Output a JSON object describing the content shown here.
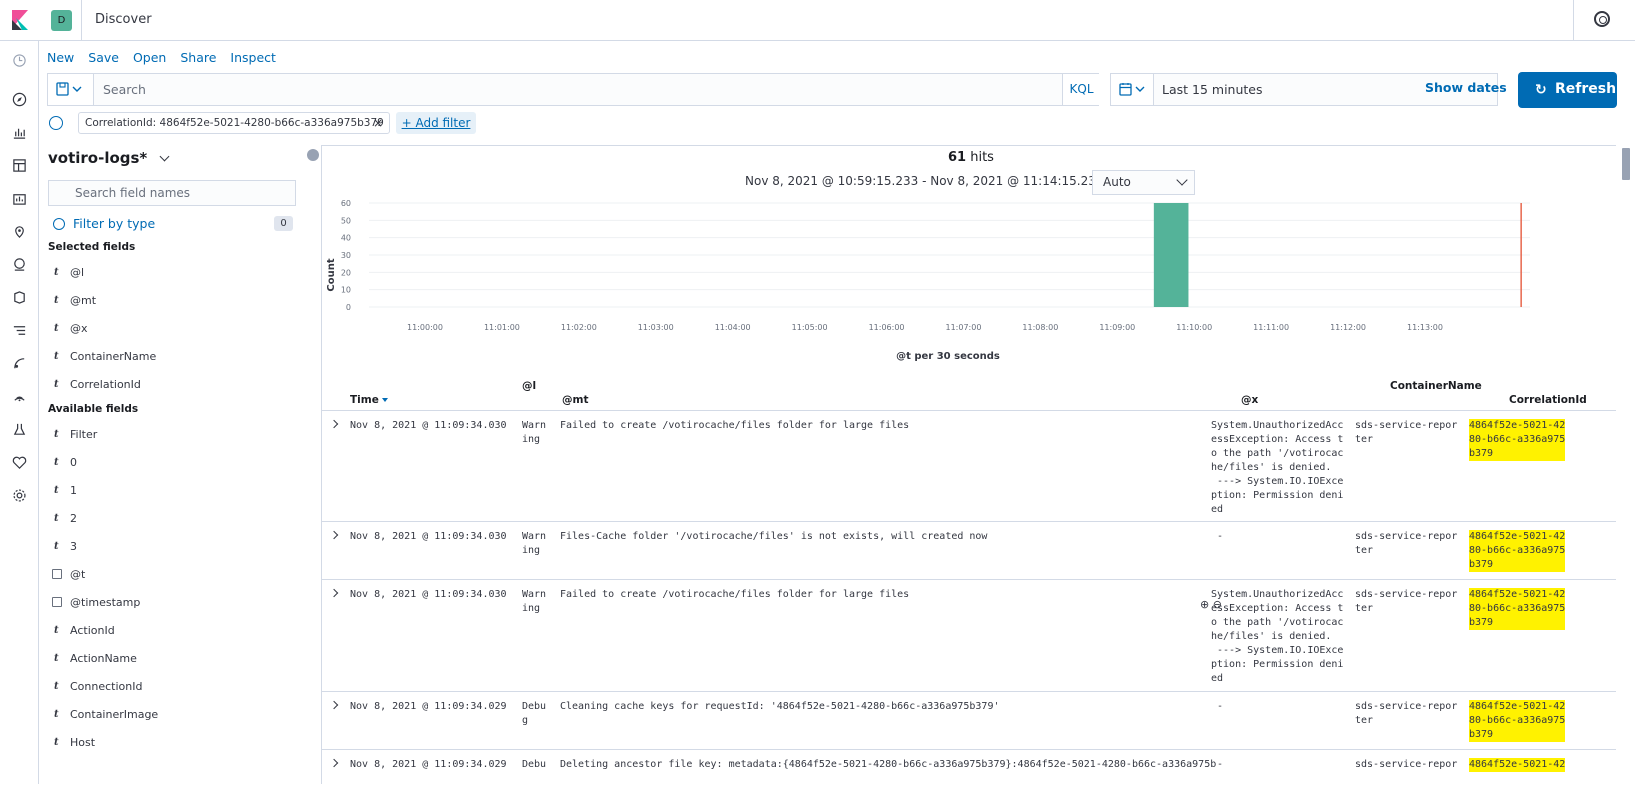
{
  "header": {
    "app_title": "Discover",
    "space_initial": "D"
  },
  "topnav": {
    "items": [
      "New",
      "Save",
      "Open",
      "Share",
      "Inspect"
    ]
  },
  "querybar": {
    "placeholder": "Search",
    "language": "KQL"
  },
  "datepicker": {
    "range": "Last 15 minutes",
    "show_dates": "Show dates",
    "refresh": "Refresh"
  },
  "filters": {
    "pills": [
      {
        "label": "CorrelationId: 4864f52e-5021-4280-b66c-a336a975b379"
      }
    ],
    "add_filter": "+ Add filter"
  },
  "sidebar": {
    "index_pattern": "votiro-logs*",
    "search_placeholder": "Search field names",
    "filter_by_type": "Filter by type",
    "filter_count": "0",
    "selected_title": "Selected fields",
    "selected_fields": [
      {
        "type": "t",
        "name": "@l"
      },
      {
        "type": "t",
        "name": "@mt"
      },
      {
        "type": "t",
        "name": "@x"
      },
      {
        "type": "t",
        "name": "ContainerName"
      },
      {
        "type": "t",
        "name": "CorrelationId"
      }
    ],
    "available_title": "Available fields",
    "available_fields": [
      {
        "type": "t",
        "name": "Filter"
      },
      {
        "type": "t",
        "name": "0"
      },
      {
        "type": "t",
        "name": "1"
      },
      {
        "type": "t",
        "name": "2"
      },
      {
        "type": "t",
        "name": "3"
      },
      {
        "type": "date",
        "name": "@t"
      },
      {
        "type": "date",
        "name": "@timestamp"
      },
      {
        "type": "t",
        "name": "ActionId"
      },
      {
        "type": "t",
        "name": "ActionName"
      },
      {
        "type": "t",
        "name": "ConnectionId"
      },
      {
        "type": "t",
        "name": "ContainerImage"
      },
      {
        "type": "t",
        "name": "Host"
      }
    ]
  },
  "results": {
    "hits": "61",
    "hits_label": "hits",
    "time_range": "Nov 8, 2021 @ 10:59:15.233 - Nov 8, 2021 @ 11:14:15.233 —",
    "interval": "Auto"
  },
  "chart_data": {
    "type": "bar",
    "ylabel": "Count",
    "xlabel": "@t per 30 seconds",
    "ylim": [
      0,
      60
    ],
    "yticks": [
      "0",
      "10",
      "20",
      "30",
      "40",
      "50",
      "60"
    ],
    "xticks": [
      "11:00:00",
      "11:01:00",
      "11:02:00",
      "11:03:00",
      "11:04:00",
      "11:05:00",
      "11:06:00",
      "11:07:00",
      "11:08:00",
      "11:09:00",
      "11:10:00",
      "11:11:00",
      "11:12:00",
      "11:13:00"
    ],
    "bars": [
      {
        "x": "11:09:30",
        "value": 61
      }
    ],
    "now_marker": "11:14:15",
    "bar_color": "#54b399",
    "marker_color": "#e7664c"
  },
  "table": {
    "headers": {
      "time": "Time",
      "level": "@l",
      "mt": "@mt",
      "x": "@x",
      "container": "ContainerName",
      "correlation": "CorrelationId"
    },
    "rows": [
      {
        "time": "Nov 8, 2021 @ 11:09:34.030",
        "level": "Warn\ning",
        "mt": "Failed to create /votirocache/files folder for large files",
        "x": "System.UnauthorizedAcc\nessException: Access t\no the path '/votirocac\nhe/files' is denied.\n ---> System.IO.IOExce\nption: Permission deni\ned",
        "container": "sds-service-repor\nter",
        "correlation": "4864f52e-5021-42\n80-b66c-a336a975\nb379"
      },
      {
        "time": "Nov 8, 2021 @ 11:09:34.030",
        "level": "Warn\ning",
        "mt": "Files-Cache folder '/votirocache/files' is not exists, will created now",
        "x": " -",
        "container": "sds-service-repor\nter",
        "correlation": "4864f52e-5021-42\n80-b66c-a336a975\nb379"
      },
      {
        "time": "Nov 8, 2021 @ 11:09:34.030",
        "level": "Warn\ning",
        "mt": "Failed to create /votirocache/files folder for large files",
        "x": "System.UnauthorizedAcc\nessException: Access t\no the path '/votirocac\nhe/files' is denied.\n ---> System.IO.IOExce\nption: Permission deni\ned",
        "container": "sds-service-repor\nter",
        "correlation": "4864f52e-5021-42\n80-b66c-a336a975\nb379"
      },
      {
        "time": "Nov 8, 2021 @ 11:09:34.029",
        "level": "Debu\ng",
        "mt": "Cleaning cache keys for requestId: '4864f52e-5021-4280-b66c-a336a975b379'",
        "x": " -",
        "container": "sds-service-repor\nter",
        "correlation": "4864f52e-5021-42\n80-b66c-a336a975\nb379"
      },
      {
        "time": "Nov 8, 2021 @ 11:09:34.029",
        "level": "Debu",
        "mt": "Deleting ancestor file key: metadata:{4864f52e-5021-4280-b66c-a336a975b379}:4864f52e-5021-4280-b66c-a336a975b",
        "x": " -",
        "container": "sds-service-repor",
        "correlation": "4864f52e-5021-42"
      }
    ]
  }
}
